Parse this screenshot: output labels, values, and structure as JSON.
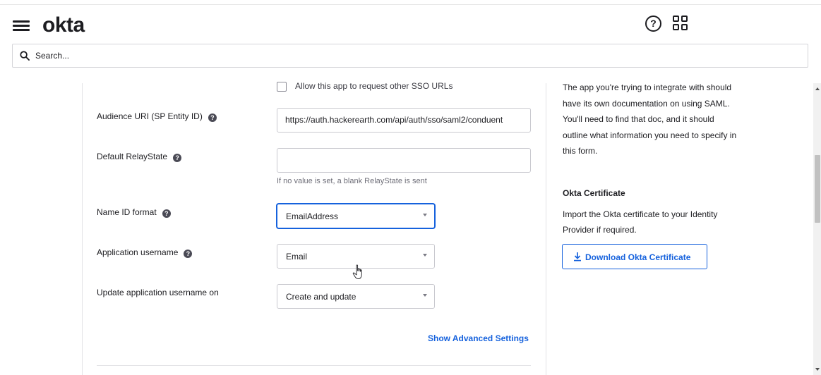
{
  "header": {
    "logo_text": "okta",
    "menu_icon": "hamburger-menu-icon",
    "help_icon": "question-circle-icon",
    "help_glyph": "?",
    "apps_icon": "apps-grid-icon"
  },
  "search": {
    "placeholder": "Search...",
    "icon": "search-icon"
  },
  "form": {
    "sso_checkbox_label": "Allow this app to request other SSO URLs",
    "audience_uri": {
      "label": "Audience URI (SP Entity ID)",
      "value": "https://auth.hackerearth.com/api/auth/sso/saml2/conduent"
    },
    "default_relay_state": {
      "label": "Default RelayState",
      "value": "",
      "hint": "If no value is set, a blank RelayState is sent"
    },
    "name_id_format": {
      "label": "Name ID format",
      "value": "EmailAddress"
    },
    "application_username": {
      "label": "Application username",
      "value": "Email"
    },
    "update_username_on": {
      "label": "Update application username on",
      "value": "Create and update"
    },
    "info_glyph": "?",
    "advanced_link": "Show Advanced Settings"
  },
  "sidebar": {
    "help_text": "The app you're trying to integrate with should have its own documentation on using SAML. You'll need to find that doc, and it should outline what information you need to specify in this form.",
    "cert_title": "Okta Certificate",
    "cert_text": "Import the Okta certificate to your Identity Provider if required.",
    "download_button": "Download Okta Certificate",
    "download_icon": "download-icon"
  },
  "colors": {
    "accent": "#1662dd",
    "text": "#1d1d21",
    "border": "#c9c9cf"
  }
}
